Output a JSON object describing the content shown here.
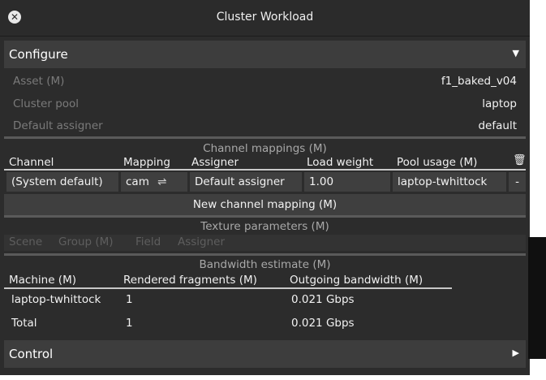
{
  "window": {
    "title": "Cluster Workload",
    "close_icon": "close-icon"
  },
  "configure": {
    "label": "Configure",
    "expand_icon": "triangle-down-icon",
    "rows": [
      {
        "key": "Asset (M)",
        "value": "f1_baked_v04"
      },
      {
        "key": "Cluster pool",
        "value": "laptop"
      },
      {
        "key": "Default assigner",
        "value": "default"
      }
    ]
  },
  "channel_mappings": {
    "title": "Channel mappings (M)",
    "headers": [
      "Channel",
      "Mapping",
      "Assigner",
      "Load weight",
      "Pool usage (M)"
    ],
    "delete_icon": "trash-icon",
    "row": {
      "channel": "(System default)",
      "mapping": "cam",
      "assigner": "Default assigner",
      "load_weight": "1.00",
      "pool_usage": "laptop-twhittock",
      "remove": "-"
    },
    "new_button": "New channel mapping (M)"
  },
  "texture_parameters": {
    "title": "Texture parameters (M)",
    "headers": [
      "Scene",
      "Group (M)",
      "Field",
      "Assigner"
    ]
  },
  "bandwidth": {
    "title": "Bandwidth estimate (M)",
    "headers": [
      "Machine (M)",
      "Rendered fragments (M)",
      "Outgoing bandwidth (M)"
    ],
    "rows": [
      {
        "machine": "laptop-twhittock",
        "fragments": "1",
        "bandwidth": "0.021 Gbps"
      },
      {
        "machine": "Total",
        "fragments": "1",
        "bandwidth": "0.021 Gbps"
      }
    ]
  },
  "control": {
    "label": "Control",
    "expand_icon": "triangle-right-icon"
  }
}
